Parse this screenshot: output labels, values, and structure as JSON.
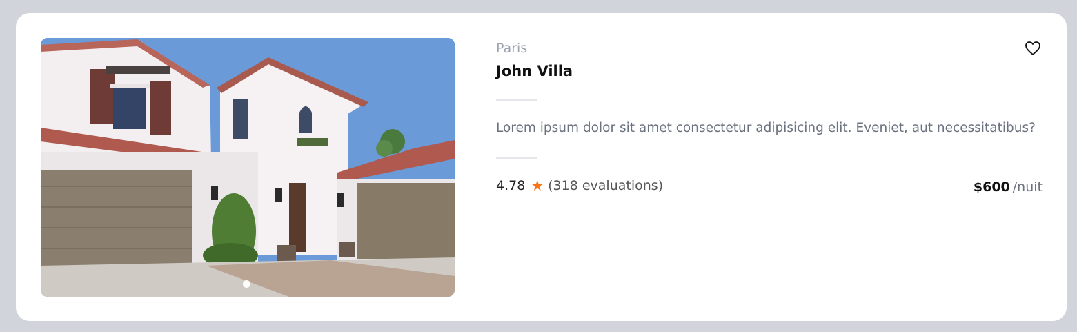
{
  "listing": {
    "location": "Paris",
    "title": "John Villa",
    "description": "Lorem ipsum dolor sit amet consectetur adipisicing elit. Eveniet, aut necessitatibus?",
    "rating": "4.78",
    "reviews": "(318 evaluations)",
    "price": "$600",
    "price_unit": "/nuit",
    "favorite_icon": "heart-outline-icon",
    "rating_icon": "star-icon"
  },
  "carousel": {
    "current_slide": 1,
    "total_slides": 1
  },
  "colors": {
    "page_background": "#d1d5db",
    "card_background": "#ffffff",
    "star": "#f97316",
    "muted_text": "#6b7280"
  }
}
